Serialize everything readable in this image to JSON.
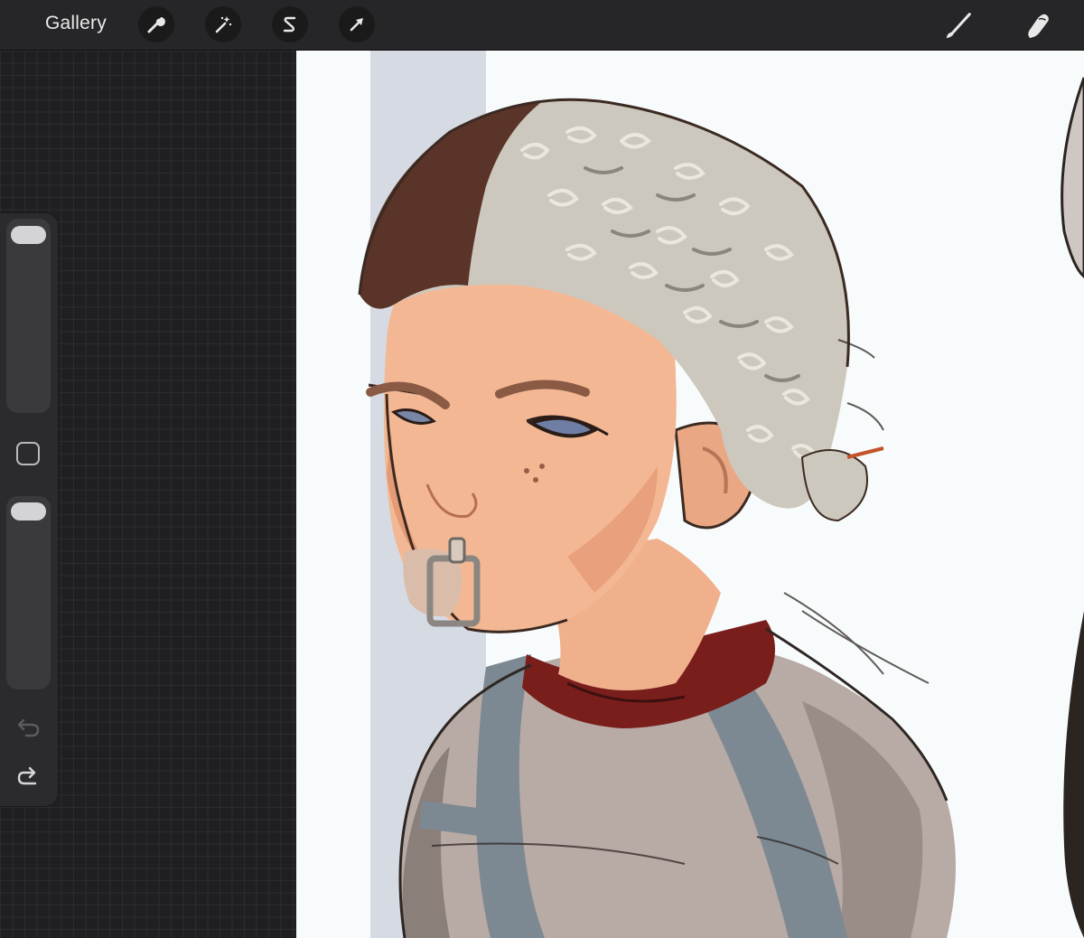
{
  "toolbar": {
    "gallery_label": "Gallery",
    "left_tools": [
      {
        "name": "adjustments-wrench-icon"
      },
      {
        "name": "magic-wand-icon"
      },
      {
        "name": "selection-s-icon"
      },
      {
        "name": "transform-arrow-icon"
      }
    ],
    "right_tools": [
      {
        "name": "brush-icon"
      },
      {
        "name": "smudge-icon"
      }
    ]
  },
  "sidebar": {
    "size_slider_level": 0.95,
    "opacity_slider_level": 0.95,
    "modify_button_icon": "square-icon",
    "undo_icon": "undo-arrow-icon",
    "redo_icon": "redo-arrow-icon"
  },
  "canvas": {
    "background_color": "#f8fbfc",
    "artwork": "character-bust-illustration"
  },
  "colors": {
    "topbar": "#262628",
    "panel": "#2b2b2d",
    "grid_bg": "#1f1f21",
    "hair_gray": "#cfcbc0",
    "hair_brown": "#5a3428",
    "skin": "#f2b892",
    "collar": "#7a1e1c",
    "shirt": "#b3a59f",
    "strap": "#7f8b93"
  }
}
